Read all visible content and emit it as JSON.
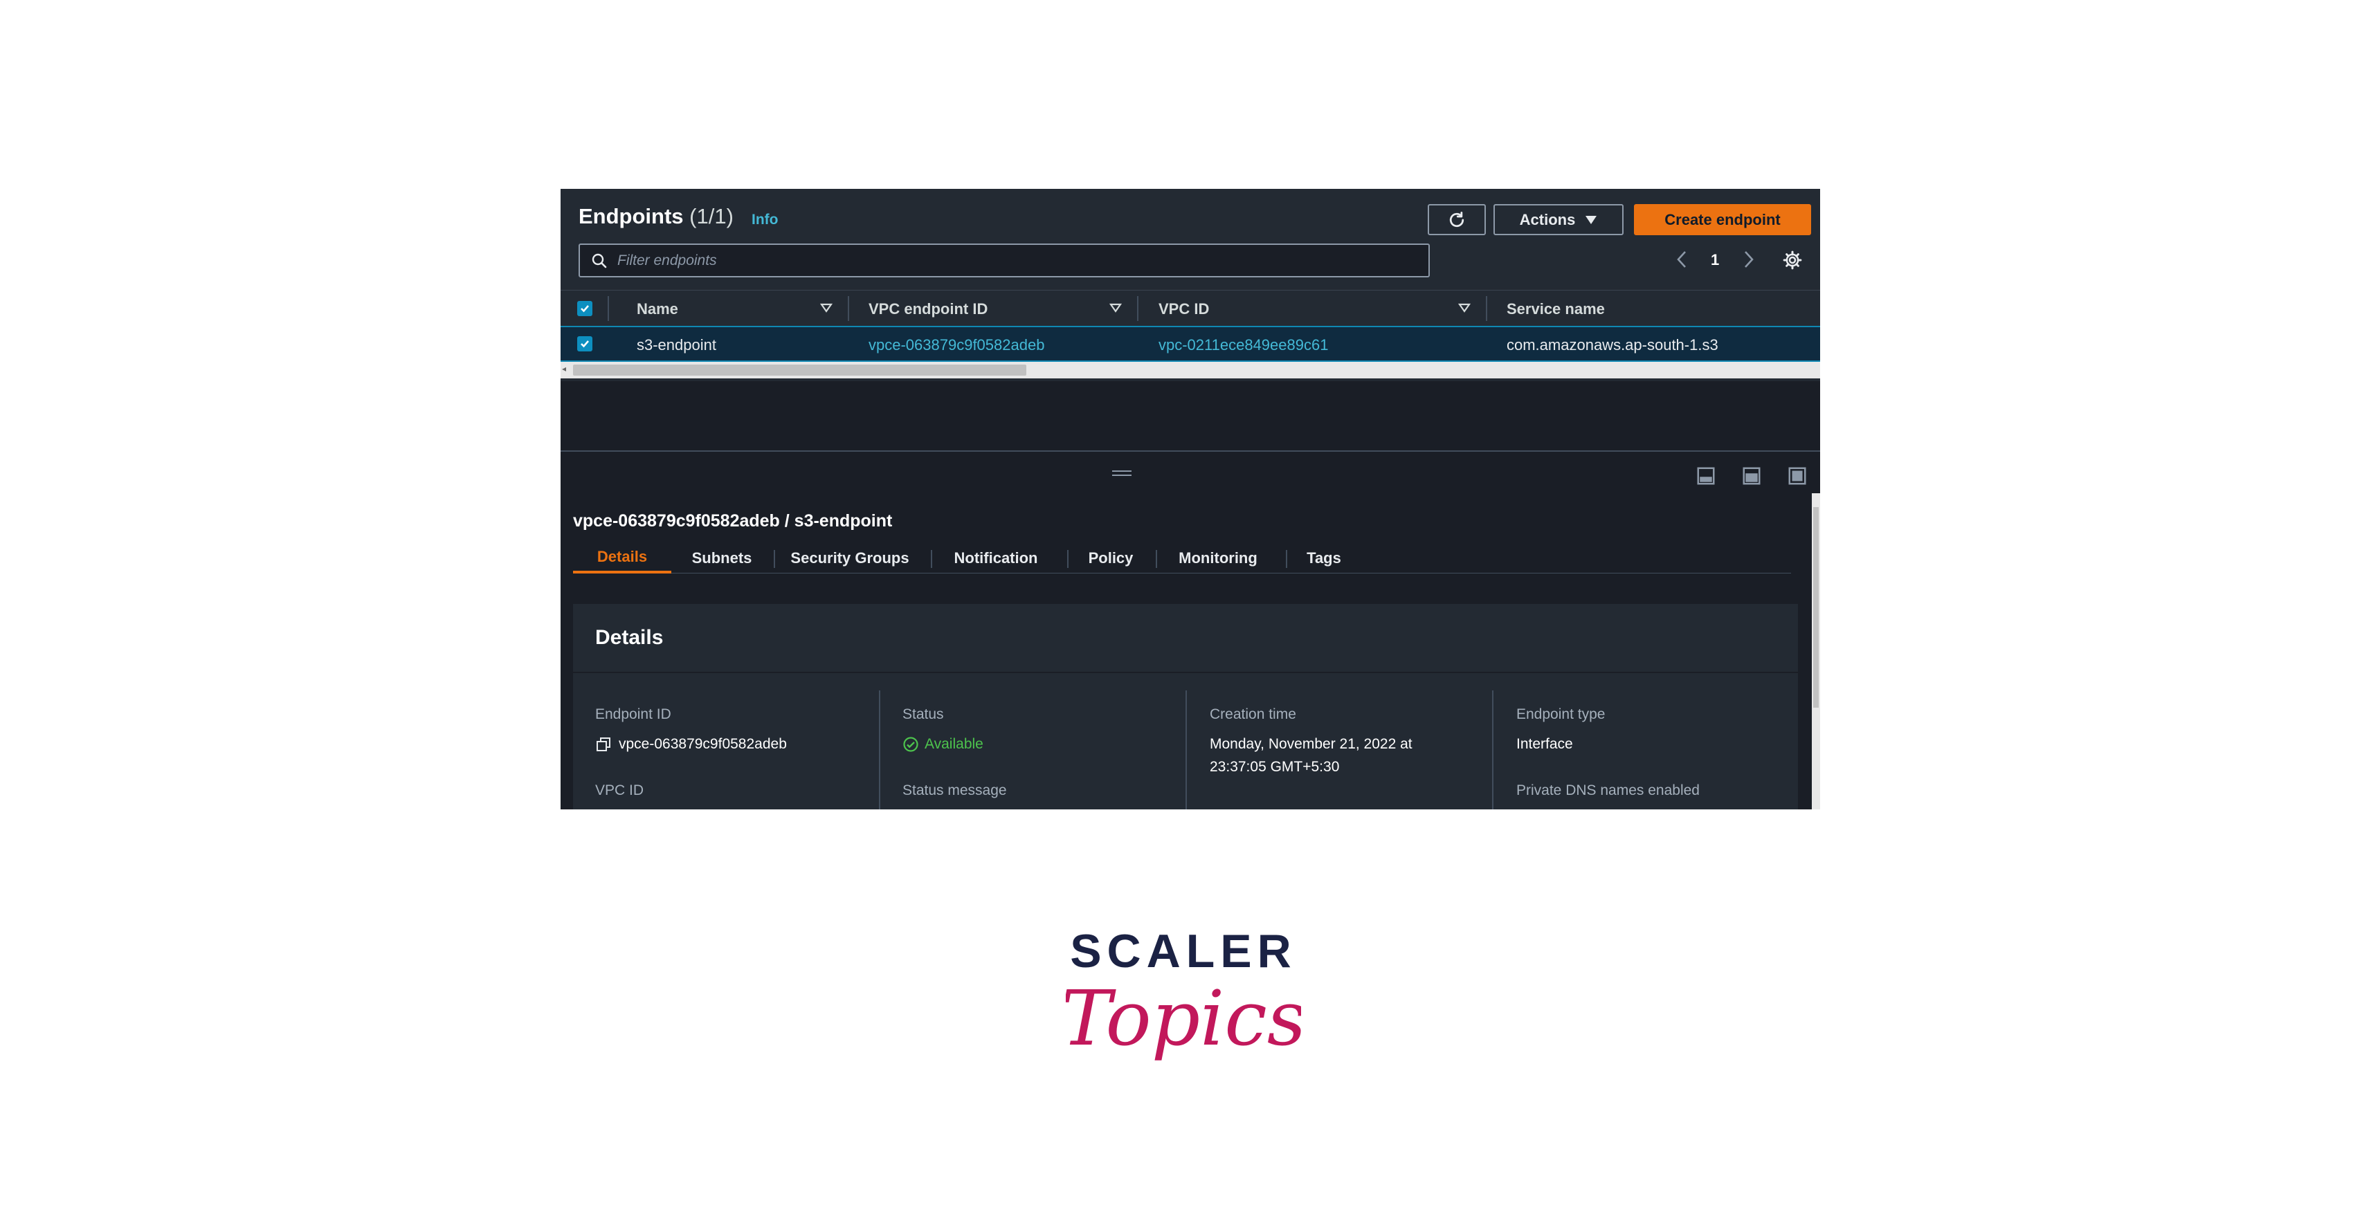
{
  "header": {
    "title": "Endpoints",
    "count": "(1/1)",
    "info_link": "Info",
    "actions_label": "Actions",
    "create_label": "Create endpoint"
  },
  "filter": {
    "placeholder": "Filter endpoints"
  },
  "pagination": {
    "page": "1"
  },
  "table": {
    "columns": [
      "Name",
      "VPC endpoint ID",
      "VPC ID",
      "Service name"
    ],
    "rows": [
      {
        "name": "s3-endpoint",
        "vpc_endpoint_id": "vpce-063879c9f0582adeb",
        "vpc_id": "vpc-0211ece849ee89c61",
        "service_name": "com.amazonaws.ap-south-1.s3"
      }
    ]
  },
  "detail": {
    "title": "vpce-063879c9f0582adeb / s3-endpoint",
    "tabs": [
      "Details",
      "Subnets",
      "Security Groups",
      "Notification",
      "Policy",
      "Monitoring",
      "Tags"
    ],
    "section_heading": "Details",
    "fields": {
      "endpoint_id_label": "Endpoint ID",
      "endpoint_id_value": "vpce-063879c9f0582adeb",
      "vpc_id_label": "VPC ID",
      "status_label": "Status",
      "status_value": "Available",
      "status_message_label": "Status message",
      "creation_time_label": "Creation time",
      "creation_time_line1": "Monday, November 21, 2022 at",
      "creation_time_line2": "23:37:05 GMT+5:30",
      "endpoint_type_label": "Endpoint type",
      "endpoint_type_value": "Interface",
      "private_dns_label": "Private DNS names enabled"
    }
  },
  "brand": {
    "line1": "SCALER",
    "line2": "Topics"
  },
  "colors": {
    "accent": "#ec7211",
    "link": "#44b9d6",
    "success": "#4dc34d",
    "brand_dark": "#1b2244",
    "brand_pink": "#c2185b"
  }
}
